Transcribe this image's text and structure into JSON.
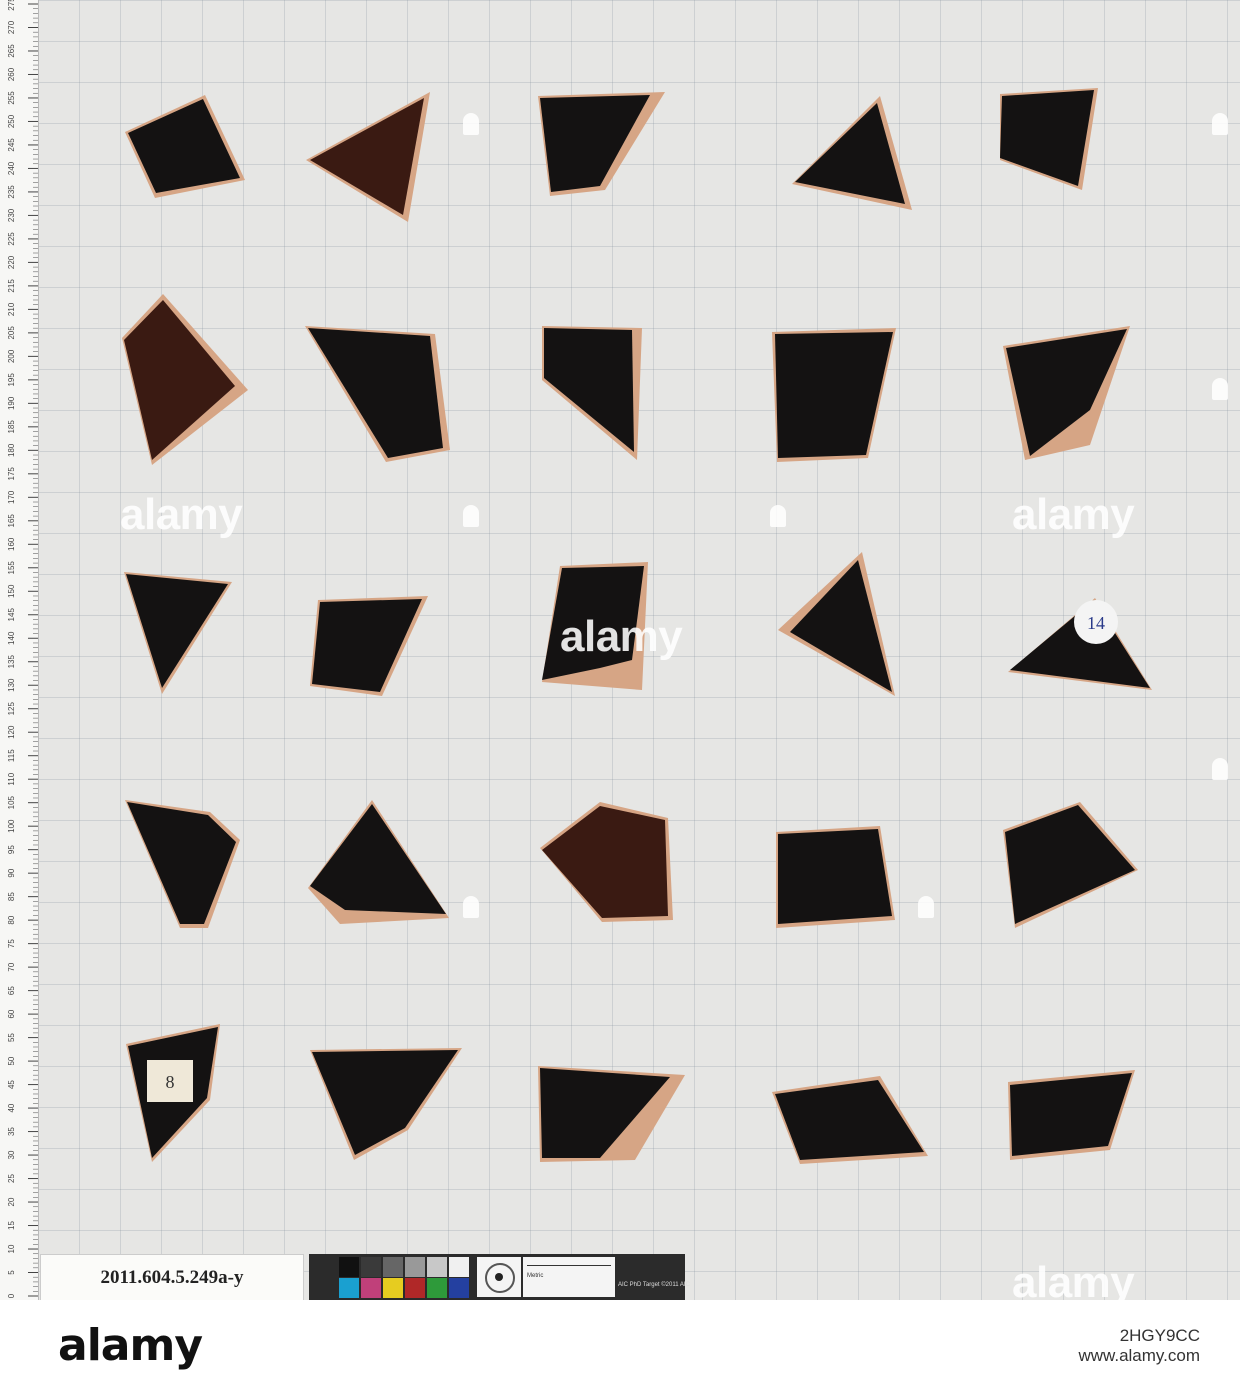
{
  "photo": {
    "background_color": "#e6e6e4",
    "ruler_ticks": [
      "275",
      "270",
      "265",
      "260",
      "255",
      "250",
      "245",
      "240",
      "235",
      "230",
      "225",
      "220",
      "215",
      "210",
      "205",
      "200",
      "195",
      "190",
      "185",
      "180",
      "175",
      "170",
      "165",
      "160",
      "155",
      "150",
      "145",
      "140",
      "135",
      "130",
      "125",
      "120",
      "115",
      "110",
      "105",
      "100",
      "95",
      "90",
      "85",
      "80",
      "75",
      "70",
      "65",
      "60",
      "55",
      "50",
      "45",
      "40",
      "35",
      "30",
      "25",
      "20",
      "15",
      "10",
      "5",
      "0"
    ],
    "accession_label": "2011.604.5.249a-y",
    "target_text": "AIC PhD Target ©2011 AIC",
    "target_scale_text": "Metric",
    "sherd_labels": [
      "14",
      "8"
    ],
    "watermark": "alamy"
  },
  "footer": {
    "logo": "alamy",
    "image_id": "2HGY9CC",
    "site": "www.alamy.com"
  },
  "colors": {
    "glaze": "#141212",
    "glaze_brown": "#3a1a12",
    "clay": "#d6a585"
  }
}
